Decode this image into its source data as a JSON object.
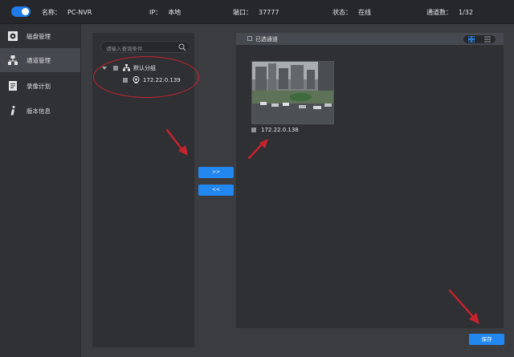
{
  "topbar": {
    "name_label": "名称：",
    "name_value": "PC-NVR",
    "ip_label": "IP：",
    "ip_value": "本地",
    "port_label": "端口：",
    "port_value": "37777",
    "status_label": "状态：",
    "status_value": "在线",
    "channels_label": "通道数：",
    "channels_value": "1/32"
  },
  "sidebar": {
    "items": [
      {
        "label": "磁盘管理",
        "icon": "disk-icon"
      },
      {
        "label": "通道管理",
        "icon": "network-icon",
        "active": true
      },
      {
        "label": "录像计划",
        "icon": "calendar-icon"
      },
      {
        "label": "版本信息",
        "icon": "info-icon"
      }
    ]
  },
  "left_panel": {
    "search_placeholder": "请输入查询条件",
    "tree_root": "默认分组",
    "tree_child": "172.22.0.139"
  },
  "buttons": {
    "add": ">>",
    "remove": "<<",
    "save": "保存"
  },
  "right_panel": {
    "title": "已选通道",
    "channel_label": "172.22.0.138"
  },
  "colors": {
    "accent": "#2387f0",
    "annotation": "#c8232c"
  }
}
